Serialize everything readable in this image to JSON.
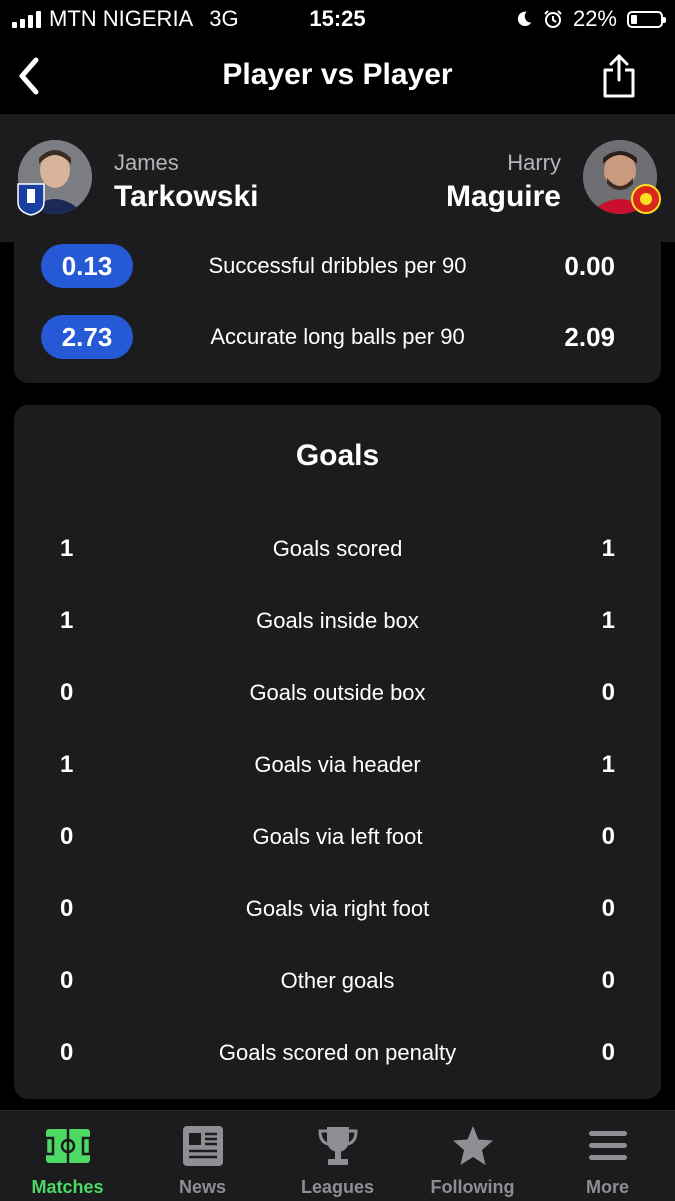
{
  "status_bar": {
    "carrier": "MTN NIGERIA",
    "network": "3G",
    "time": "15:25",
    "battery": "22%",
    "battery_level": 0.22
  },
  "nav": {
    "title": "Player vs Player",
    "back_icon": "chevron-left-icon",
    "share_icon": "share-icon"
  },
  "players": {
    "left": {
      "first_name": "James",
      "last_name": "Tarkowski",
      "club_crest": "everton-crest"
    },
    "right": {
      "first_name": "Harry",
      "last_name": "Maguire",
      "club_crest": "man-utd-crest"
    }
  },
  "previous_stats": [
    {
      "left": "0.13",
      "label": "Successful dribbles per 90",
      "right": "0.00"
    },
    {
      "left": "2.73",
      "label": "Accurate long balls per 90",
      "right": "2.09"
    }
  ],
  "goals": {
    "title": "Goals",
    "rows": [
      {
        "left": "1",
        "label": "Goals scored",
        "right": "1"
      },
      {
        "left": "1",
        "label": "Goals inside box",
        "right": "1"
      },
      {
        "left": "0",
        "label": "Goals outside box",
        "right": "0"
      },
      {
        "left": "1",
        "label": "Goals via header",
        "right": "1"
      },
      {
        "left": "0",
        "label": "Goals via left foot",
        "right": "0"
      },
      {
        "left": "0",
        "label": "Goals via right foot",
        "right": "0"
      },
      {
        "left": "0",
        "label": "Other goals",
        "right": "0"
      },
      {
        "left": "0",
        "label": "Goals scored on penalty",
        "right": "0"
      }
    ]
  },
  "tabs": [
    {
      "label": "Matches",
      "icon": "pitch-icon",
      "active": true
    },
    {
      "label": "News",
      "icon": "newspaper-icon",
      "active": false
    },
    {
      "label": "Leagues",
      "icon": "trophy-icon",
      "active": false
    },
    {
      "label": "Following",
      "icon": "star-icon",
      "active": false
    },
    {
      "label": "More",
      "icon": "menu-icon",
      "active": false
    }
  ],
  "colors": {
    "accent_pill": "#2559d6",
    "active_tab": "#4cd964",
    "card_bg": "#1c1c1e"
  }
}
